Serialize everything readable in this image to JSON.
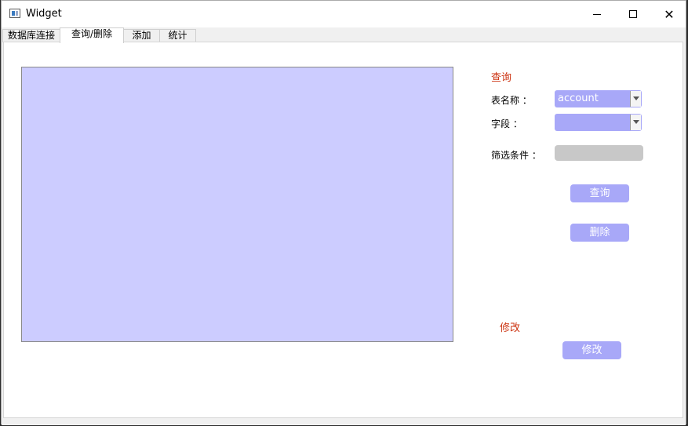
{
  "window": {
    "title": "Widget",
    "icons": {
      "app": "app-window-icon",
      "minimize": "minimize-icon",
      "maximize": "maximize-icon",
      "close": "close-icon"
    },
    "close_glyph": "✕"
  },
  "tabs": [
    {
      "label": "数据库连接",
      "active": false
    },
    {
      "label": "查询/删除",
      "active": true
    },
    {
      "label": "添加",
      "active": false
    },
    {
      "label": "统计",
      "active": false
    }
  ],
  "query": {
    "section_title": "查询",
    "table_label": "表名称 ：",
    "table_value": "account",
    "field_label": "字段  ：",
    "field_value": "",
    "filter_label": "筛选条件 ：",
    "filter_value": "",
    "query_button": "查询",
    "delete_button": "删除"
  },
  "modify": {
    "section_title": "修改",
    "modify_button": "修改"
  },
  "colors": {
    "table_bg": "#ccccff",
    "accent": "#a8a8f8",
    "section_title": "#cc3311"
  }
}
